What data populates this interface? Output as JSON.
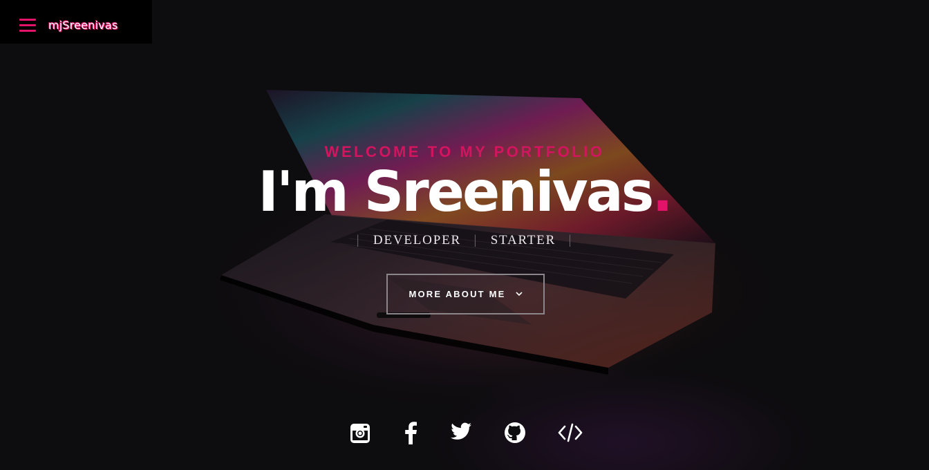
{
  "nav": {
    "brand": "mjSreenivas",
    "menu_icon": "hamburger-menu-icon"
  },
  "hero": {
    "welcome": "WELCOME TO MY PORTFOLIO",
    "headline": "I'm Sreenivas",
    "headline_dot": ".",
    "roles": [
      "DEVELOPER",
      "STARTER"
    ],
    "role_separator": "|",
    "cta_label": "MORE ABOUT ME",
    "cta_icon": "chevron-down-icon"
  },
  "social": [
    {
      "name": "instagram-icon"
    },
    {
      "name": "facebook-icon"
    },
    {
      "name": "twitter-icon"
    },
    {
      "name": "github-icon"
    },
    {
      "name": "code-icon"
    }
  ],
  "colors": {
    "accent": "#e3136a",
    "background": "#0c0b0d",
    "text": "#ffffff"
  }
}
